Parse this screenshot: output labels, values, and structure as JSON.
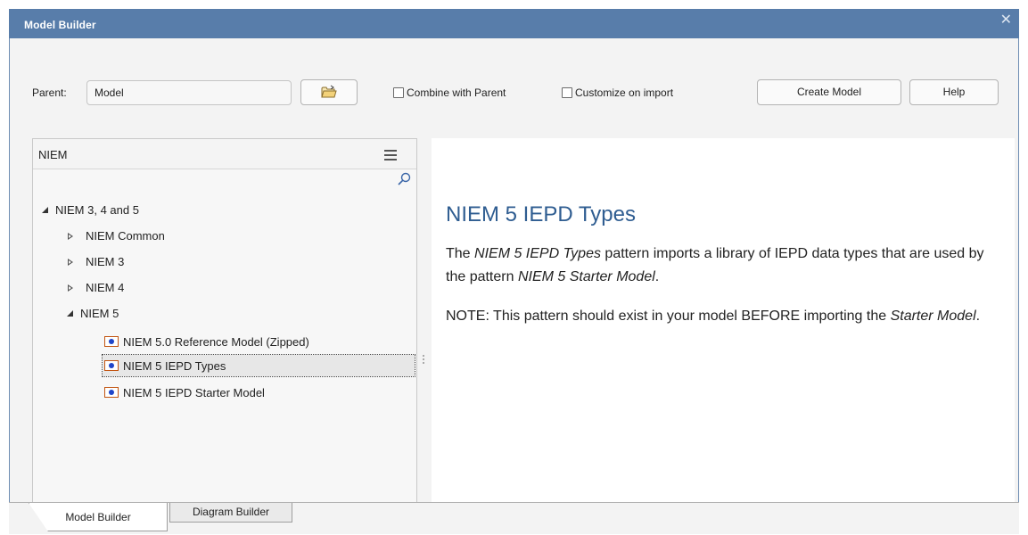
{
  "window": {
    "title": "Model Builder",
    "close_icon": "close-icon"
  },
  "toolbar": {
    "parent_label": "Parent:",
    "parent_value": "Model",
    "browse_icon": "folder-open-icon",
    "combine_label": "Combine with Parent",
    "combine_checked": false,
    "customize_label": "Customize on import",
    "customize_checked": false,
    "create_label": "Create Model",
    "help_label": "Help"
  },
  "tree": {
    "header": "NIEM",
    "root": {
      "label": "NIEM 3, 4 and 5",
      "expanded": true
    },
    "children": [
      {
        "label": "NIEM Common",
        "expanded": false
      },
      {
        "label": "NIEM 3",
        "expanded": false
      },
      {
        "label": "NIEM 4",
        "expanded": false
      },
      {
        "label": "NIEM 5",
        "expanded": true
      }
    ],
    "niem5_items": [
      {
        "label": "NIEM 5.0 Reference Model (Zipped)",
        "selected": false
      },
      {
        "label": "NIEM 5 IEPD Types",
        "selected": true
      },
      {
        "label": "NIEM 5 IEPD Starter Model",
        "selected": false
      }
    ]
  },
  "detail": {
    "title": "NIEM 5 IEPD Types",
    "p1_a": "The ",
    "p1_em1": "NIEM 5 IEPD Types",
    "p1_b": " pattern imports a library of IEPD data types that are used by the pattern ",
    "p1_em2": "NIEM 5 Starter Model",
    "p1_c": ".",
    "p2_a": "NOTE:  This pattern should exist in your model BEFORE importing the ",
    "p2_em": "Starter Model",
    "p2_b": "."
  },
  "tabs": [
    {
      "label": "Model Builder",
      "active": true
    },
    {
      "label": "Diagram Builder",
      "active": false
    }
  ],
  "colors": {
    "titlebar": "#587daa",
    "accent_title": "#2f5d91",
    "pkg_border": "#c25512",
    "pkg_dot": "#1f45c9"
  }
}
